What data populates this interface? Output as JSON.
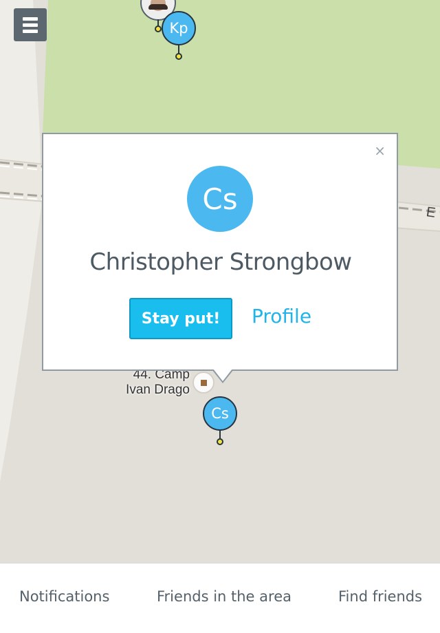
{
  "map": {
    "menu_icon": "menu-icon",
    "pins": {
      "kp": {
        "initials": "Kp",
        "color": "#4bb8f0"
      },
      "cs": {
        "initials": "Cs",
        "color": "#4bb8f0"
      }
    },
    "poi": {
      "label_line1": "44. Camp",
      "label_line2": "Ivan Drago",
      "icon": "camp-icon"
    },
    "road_label": "E"
  },
  "popup": {
    "close_icon": "×",
    "avatar_initials": "Cs",
    "name": "Christopher Strongbow",
    "primary_button": "Stay put!",
    "secondary_link": "Profile"
  },
  "tabs": {
    "notifications": "Notifications",
    "friends_area": "Friends in the area",
    "find_friends": "Find friends"
  },
  "colors": {
    "accent": "#19bdee",
    "pin": "#4bb8f0",
    "park": "#cadfa9",
    "ground": "#e2dfd8"
  }
}
